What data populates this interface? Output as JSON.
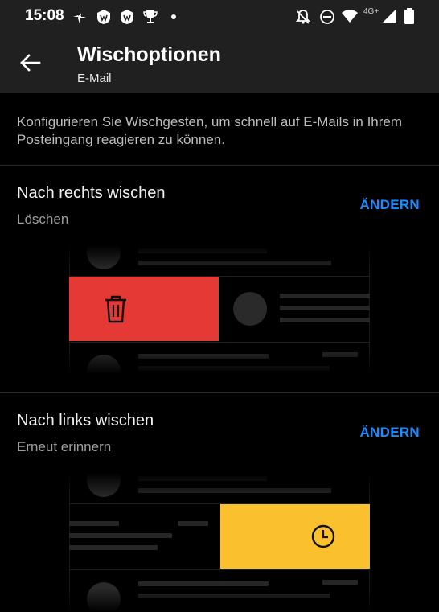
{
  "status_bar": {
    "time": "15:08",
    "network": "4G+",
    "left_icons": [
      "pinwheel-icon",
      "shield-app-icon",
      "shield-app-icon",
      "trophy-icon",
      "dot-icon"
    ],
    "right_icons": [
      "bell-off-icon",
      "do-not-disturb-icon",
      "wifi-icon",
      "signal-icon",
      "battery-icon"
    ]
  },
  "header": {
    "title": "Wischoptionen",
    "subtitle": "E-Mail"
  },
  "intro_text": "Konfigurieren Sie Wischgesten, um schnell auf E-Mails in Ihrem Posteingang reagieren zu können.",
  "swipe_right": {
    "title": "Nach rechts wischen",
    "action": "Löschen",
    "change_label": "ÄNDERN",
    "action_color": "#e53935",
    "icon": "trash-icon"
  },
  "swipe_left": {
    "title": "Nach links wischen",
    "action": "Erneut erinnern",
    "change_label": "ÄNDERN",
    "action_color": "#fbc02d",
    "icon": "clock-icon"
  },
  "colors": {
    "accent": "#1a8cff",
    "header_bg": "#202020",
    "background": "#000000"
  }
}
